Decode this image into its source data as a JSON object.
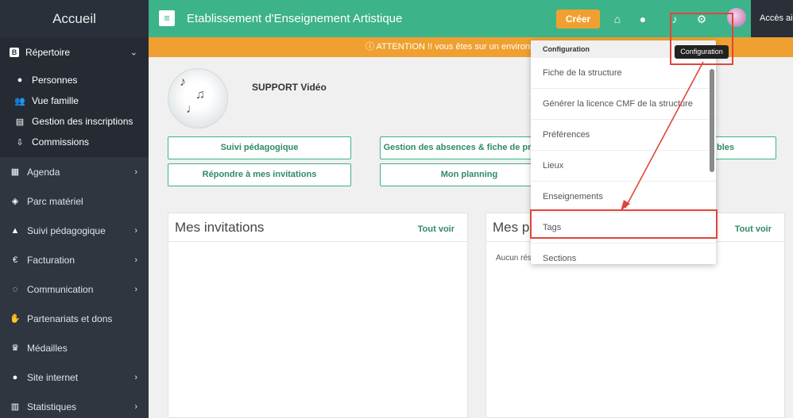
{
  "sidebar": {
    "brand": "Accueil",
    "repertoire": "Répertoire",
    "sub_items": [
      {
        "label": "Personnes",
        "icon": "user-icon"
      },
      {
        "label": "Vue famille",
        "icon": "family-icon"
      },
      {
        "label": "Gestion des inscriptions",
        "icon": "list-icon"
      },
      {
        "label": "Commissions",
        "icon": "commission-icon"
      }
    ],
    "items": [
      {
        "label": "Agenda",
        "icon": "calendar-icon",
        "has_chevron": true
      },
      {
        "label": "Parc matériel",
        "icon": "box-icon",
        "has_chevron": false
      },
      {
        "label": "Suivi pédagogique",
        "icon": "graduation-cap-icon",
        "has_chevron": true
      },
      {
        "label": "Facturation",
        "icon": "euro-icon",
        "has_chevron": true
      },
      {
        "label": "Communication",
        "icon": "chat-icon",
        "has_chevron": true
      },
      {
        "label": "Partenariats et dons",
        "icon": "handshake-icon",
        "has_chevron": false
      },
      {
        "label": "Médailles",
        "icon": "trophy-icon",
        "has_chevron": false
      },
      {
        "label": "Site internet",
        "icon": "globe-icon",
        "has_chevron": true
      },
      {
        "label": "Statistiques",
        "icon": "bar-chart-icon",
        "has_chevron": true
      }
    ]
  },
  "topbar": {
    "title": "Etablissement d'Enseignement Artistique",
    "create_label": "Créer",
    "access_label": "Accès aide"
  },
  "alert": {
    "text": "ATTENTION !! vous êtes sur un environne"
  },
  "profile": {
    "name": "SUPPORT Vidéo"
  },
  "actions": {
    "suivi": "Suivi pédagogique",
    "absences": "Gestion des absences & fiche de pr",
    "bles": "bles",
    "invitations": "Répondre à mes invitations",
    "planning": "Mon planning"
  },
  "panels": {
    "left_title": "Mes invitations",
    "left_link": "Tout voir",
    "right_title": "Mes p",
    "right_link": "Tout voir",
    "right_empty": "Aucun rés"
  },
  "dropdown": {
    "header": "Configuration",
    "items": [
      "Fiche de la structure",
      "Générer la licence CMF de la structure",
      "Préférences",
      "Lieux",
      "Enseignements",
      "Tags",
      "Sections"
    ]
  },
  "tooltip": "Configuration",
  "colors": {
    "sidebar": "#2f3640",
    "topbar": "#3db389",
    "alert": "#f0a030",
    "highlight": "#e0463a"
  }
}
